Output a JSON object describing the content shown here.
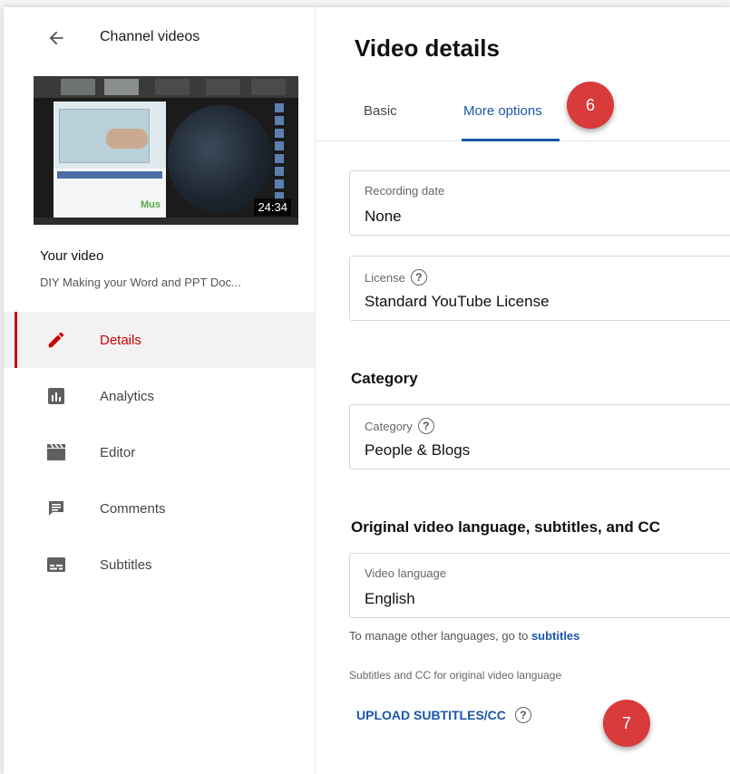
{
  "sidebar": {
    "header_title": "Channel videos",
    "thumbnail": {
      "duration": "24:34",
      "logo_text": "Mus"
    },
    "your_video_label": "Your video",
    "video_title": "DIY Making your Word and PPT Doc...",
    "nav": [
      {
        "label": "Details",
        "icon": "pencil-icon",
        "active": true
      },
      {
        "label": "Analytics",
        "icon": "analytics-icon",
        "active": false
      },
      {
        "label": "Editor",
        "icon": "clapperboard-icon",
        "active": false
      },
      {
        "label": "Comments",
        "icon": "comment-icon",
        "active": false
      },
      {
        "label": "Subtitles",
        "icon": "subtitles-icon",
        "active": false
      }
    ]
  },
  "main": {
    "title": "Video details",
    "tabs": [
      {
        "label": "Basic",
        "active": false
      },
      {
        "label": "More options",
        "active": true
      }
    ],
    "callouts": {
      "step6": "6",
      "step7": "7"
    },
    "recording_date": {
      "label": "Recording date",
      "value": "None"
    },
    "license": {
      "label": "License",
      "value": "Standard YouTube License"
    },
    "category_section": {
      "heading": "Category",
      "label": "Category",
      "value": "People & Blogs"
    },
    "language_section": {
      "heading": "Original video language, subtitles, and CC",
      "label": "Video language",
      "value": "English",
      "manage_text": "To manage other languages, go to",
      "manage_link": "subtitles",
      "subtitles_text": "Subtitles and CC for original video language",
      "upload_label": "UPLOAD SUBTITLES/CC"
    }
  },
  "colors": {
    "accent_blue": "#1a56a8",
    "active_red": "#cc0000",
    "callout_red": "#d93a3a"
  }
}
